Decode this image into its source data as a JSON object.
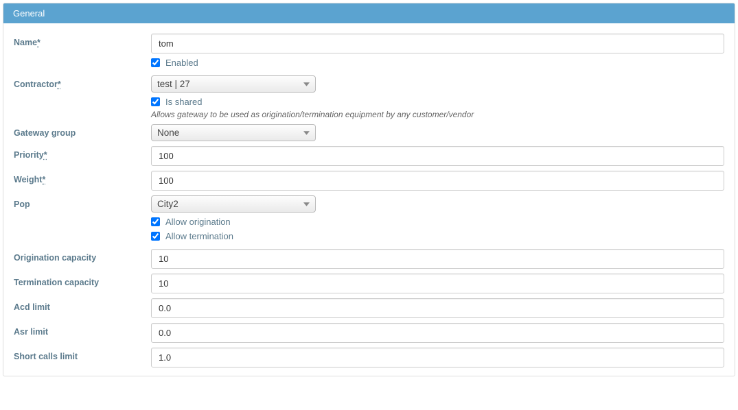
{
  "panel": {
    "title": "General"
  },
  "labels": {
    "name": "Name",
    "contractor": "Contractor",
    "gateway_group": "Gateway group",
    "priority": "Priority",
    "weight": "Weight",
    "pop": "Pop",
    "origination_capacity": "Origination capacity",
    "termination_capacity": "Termination capacity",
    "acd_limit": "Acd limit",
    "asr_limit": "Asr limit",
    "short_calls_limit": "Short calls limit",
    "required_marker": "*"
  },
  "checkboxes": {
    "enabled": "Enabled",
    "is_shared": "Is shared",
    "allow_origination": "Allow origination",
    "allow_termination": "Allow termination"
  },
  "values": {
    "name": "tom",
    "contractor": "test | 27",
    "gateway_group": "None",
    "priority": "100",
    "weight": "100",
    "pop": "City2",
    "origination_capacity": "10",
    "termination_capacity": "10",
    "acd_limit": "0.0",
    "asr_limit": "0.0",
    "short_calls_limit": "1.0"
  },
  "hints": {
    "is_shared": "Allows gateway to be used as origination/termination equipment by any customer/vendor"
  }
}
